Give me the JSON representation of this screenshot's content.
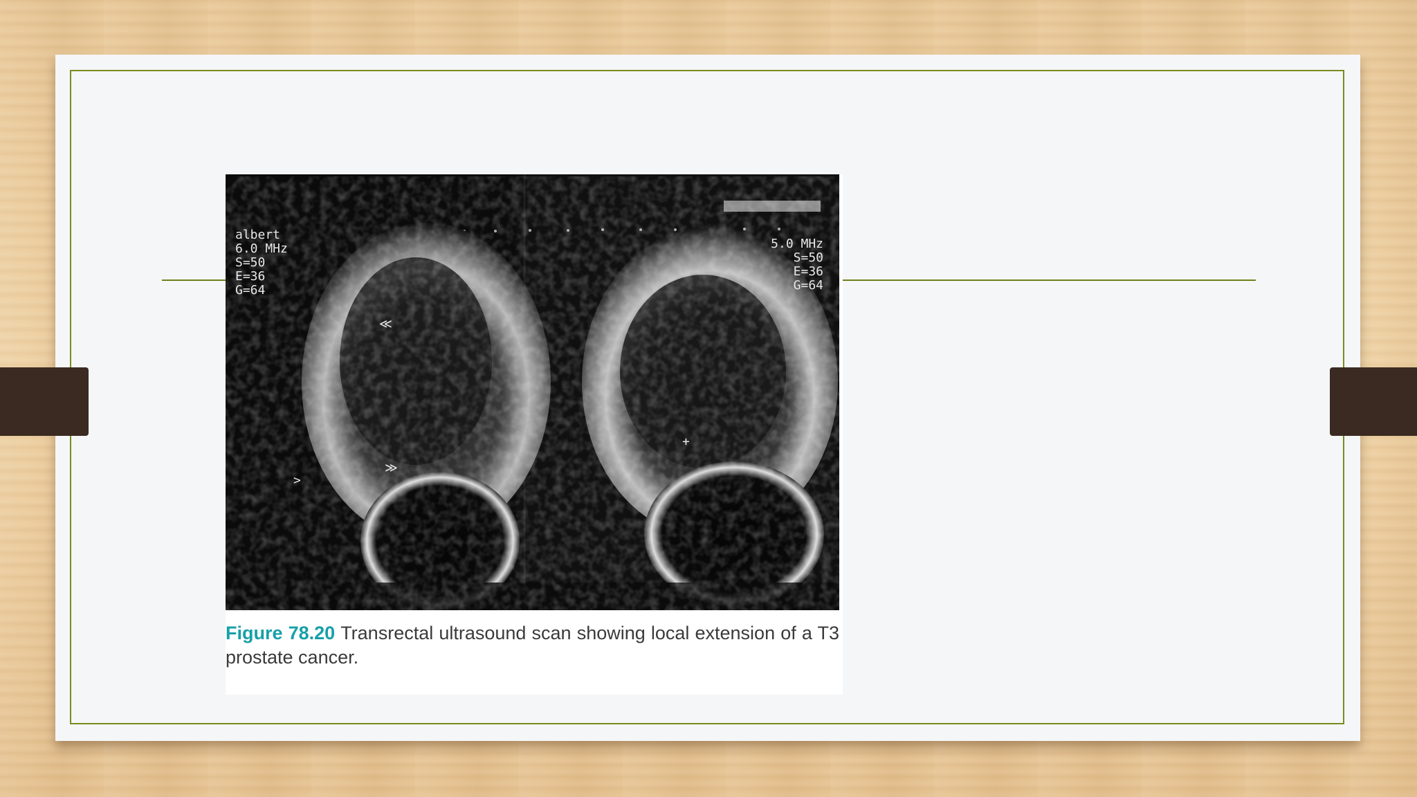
{
  "figure": {
    "label": "Figure 78.20",
    "caption": "Transrectal ultrasound scan showing local extension of a T3 prostate cancer."
  },
  "scan_overlay": {
    "left_lines": [
      "albert",
      "6.0 MHz",
      "S=50",
      "E=36",
      "G=64"
    ],
    "right_lines": [
      "5.0 MHz",
      "S=50",
      "E=36",
      "G=64"
    ]
  },
  "colors": {
    "accent_line": "#7a8a1e",
    "figure_label": "#17a0a8",
    "tab": "#3a2a22"
  }
}
